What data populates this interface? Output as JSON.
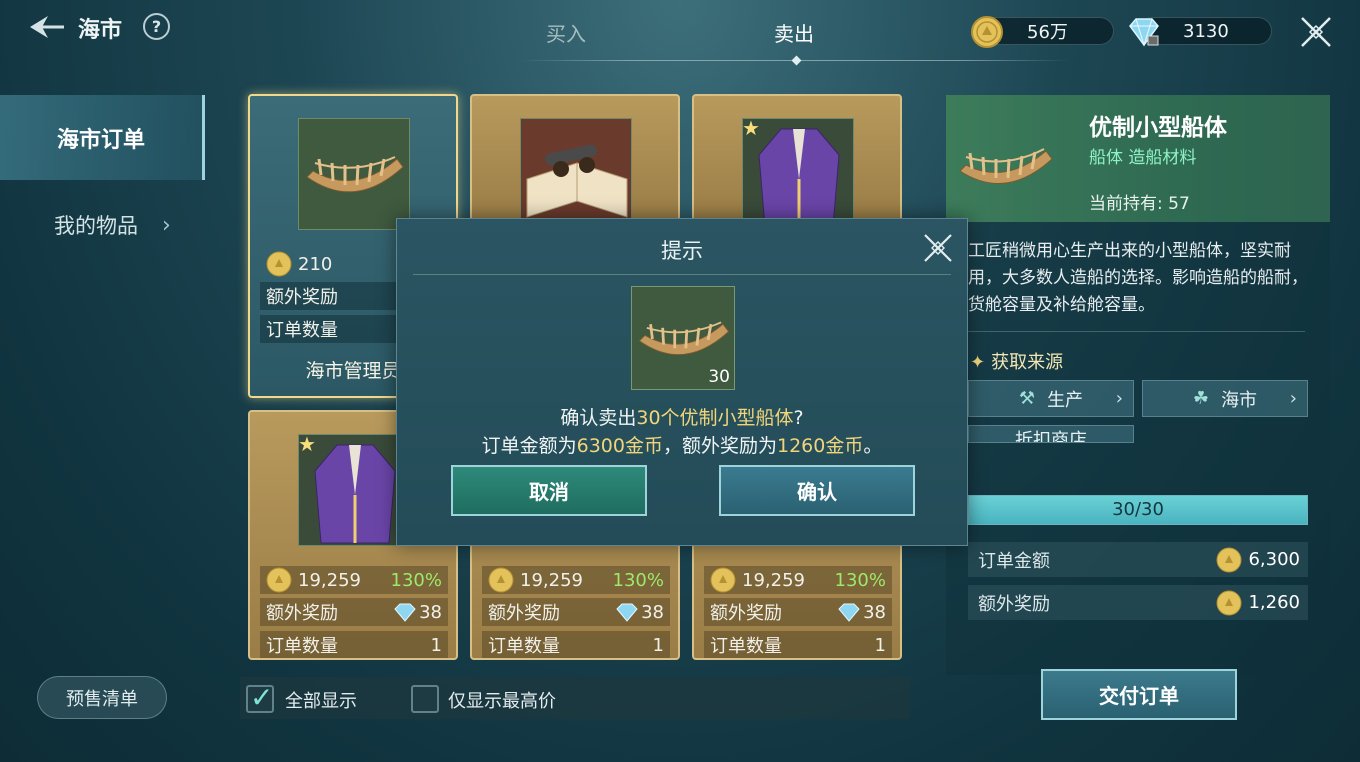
{
  "header": {
    "title": "海市",
    "help": "?",
    "tabs": [
      {
        "label": "买入",
        "active": false
      },
      {
        "label": "卖出",
        "active": true
      }
    ],
    "gold": "56万",
    "gems": "3130"
  },
  "sidebar": {
    "items": [
      {
        "label": "海市订单",
        "active": true
      },
      {
        "label": "我的物品",
        "active": false
      }
    ],
    "presale_label": "预售清单"
  },
  "cards": [
    {
      "item": "hull",
      "starred": false,
      "price": "210",
      "extra_label": "额外奖励",
      "qty_label": "订单数量",
      "source": "海市管理员",
      "selected": true
    },
    {
      "item": "cannon-book",
      "starred": false
    },
    {
      "item": "purple-coat",
      "starred": true
    },
    {
      "item": "purple-coat",
      "starred": true,
      "price": "19,259",
      "pct": "130%",
      "extra_label": "额外奖励",
      "extra_gems": "38",
      "qty_label": "订单数量",
      "qty": "1"
    },
    {
      "item": "purple-coat",
      "starred": true,
      "price": "19,259",
      "pct": "130%",
      "extra_label": "额外奖励",
      "extra_gems": "38",
      "qty_label": "订单数量",
      "qty": "1"
    },
    {
      "item": "purple-coat",
      "starred": true,
      "price": "19,259",
      "pct": "130%",
      "extra_label": "额外奖励",
      "extra_gems": "38",
      "qty_label": "订单数量",
      "qty": "1"
    }
  ],
  "filters": {
    "show_all": {
      "label": "全部显示",
      "checked": true
    },
    "highest_only": {
      "label": "仅显示最高价",
      "checked": false
    }
  },
  "detail": {
    "name": "优制小型船体",
    "tags": "船体 造船材料",
    "held_label": "当前持有:",
    "held": "57",
    "description": "工匠稍微用心生产出来的小型船体，坚实耐用，大多数人造船的选择。影响造船的船耐，货舱容量及补给舱容量。",
    "source_title": "获取来源",
    "sources": [
      "生产",
      "海市",
      "折扣商店"
    ],
    "progress_text": "30/30",
    "progress_fraction": 1.0,
    "order_amount_label": "订单金额",
    "order_amount": "6,300",
    "extra_reward_label": "额外奖励",
    "extra_reward": "1,260",
    "deliver_label": "交付订单"
  },
  "dialog": {
    "title": "提示",
    "item_qty": "30",
    "line1_prefix": "确认卖出",
    "line1_highlight": "30个优制小型船体",
    "line1_suffix": "?",
    "line2_a": "订单金额为",
    "line2_b": "6300金币",
    "line2_c": "，额外奖励为",
    "line2_d": "1260金币",
    "line2_e": "。",
    "cancel_label": "取消",
    "confirm_label": "确认"
  },
  "colors": {
    "accent_gold": "#f1d57a",
    "percent_green": "#9ee96a",
    "tag_green": "#8ff2c4"
  }
}
